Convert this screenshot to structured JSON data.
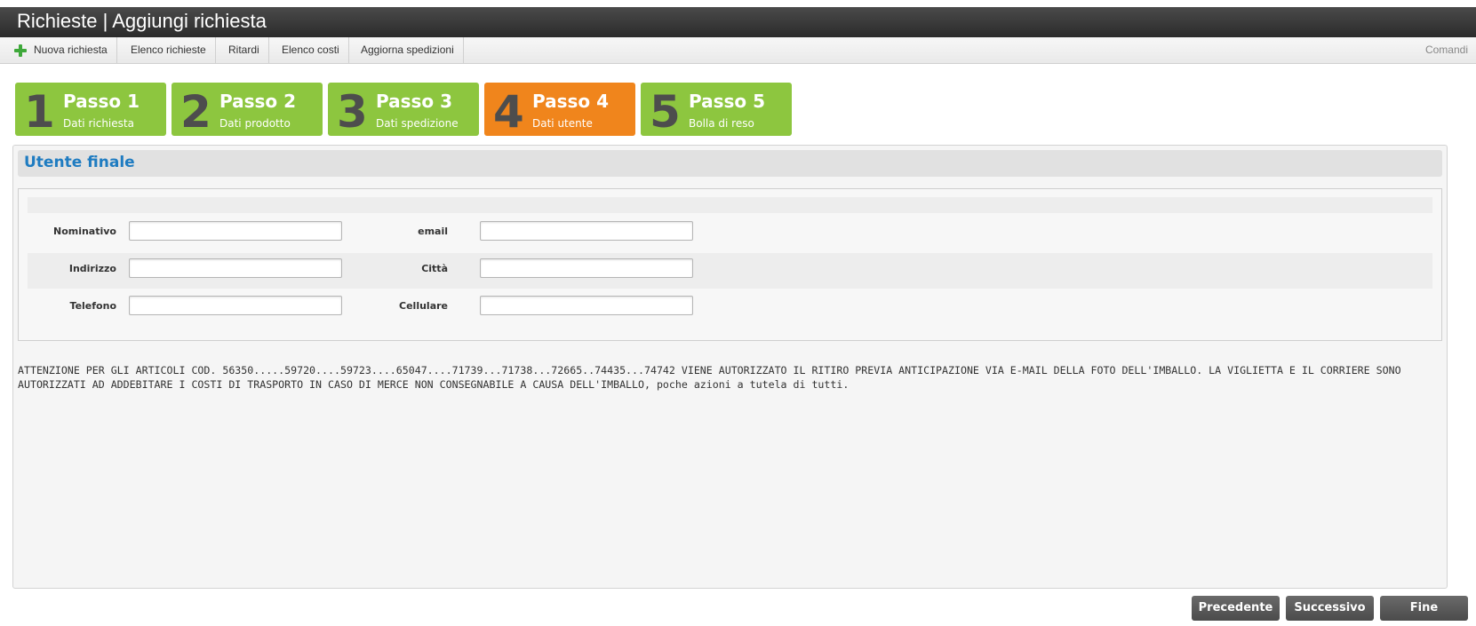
{
  "window": {
    "title": "Richieste | Aggiungi richiesta"
  },
  "toolbar": {
    "items": [
      {
        "label": "Nuova richiesta",
        "icon": "plus-icon"
      },
      {
        "label": "Elenco richieste"
      },
      {
        "label": "Ritardi"
      },
      {
        "label": "Elenco costi"
      },
      {
        "label": "Aggiorna spedizioni"
      }
    ],
    "comandi": "Comandi"
  },
  "steps": [
    {
      "num": "1",
      "title": "Passo 1",
      "subtitle": "Dati richiesta",
      "active": false
    },
    {
      "num": "2",
      "title": "Passo 2",
      "subtitle": "Dati prodotto",
      "active": false
    },
    {
      "num": "3",
      "title": "Passo 3",
      "subtitle": "Dati spedizione",
      "active": false
    },
    {
      "num": "4",
      "title": "Passo 4",
      "subtitle": "Dati utente",
      "active": true
    },
    {
      "num": "5",
      "title": "Passo 5",
      "subtitle": "Bolla di reso",
      "active": false
    }
  ],
  "colors": {
    "step_green": "#8dc63f",
    "step_active": "#f0851c",
    "section_title": "#1f7cc1",
    "button_bg": "#555555"
  },
  "section": {
    "title": "Utente finale"
  },
  "form": {
    "nominativo": {
      "label": "Nominativo",
      "value": ""
    },
    "email": {
      "label": "email",
      "value": ""
    },
    "indirizzo": {
      "label": "Indirizzo",
      "value": ""
    },
    "citta": {
      "label": "Città",
      "value": ""
    },
    "telefono": {
      "label": "Telefono",
      "value": ""
    },
    "cellulare": {
      "label": "Cellulare",
      "value": ""
    }
  },
  "notice": "ATTENZIONE PER GLI ARTICOLI COD. 56350.....59720....59723....65047....71739...71738...72665..74435...74742 VIENE AUTORIZZATO IL RITIRO PREVIA ANTICIPAZIONE VIA E-MAIL DELLA FOTO DELL'IMBALLO. LA VIGLIETTA E IL CORRIERE SONO AUTORIZZATI AD ADDEBITARE I COSTI DI TRASPORTO IN CASO DI MERCE NON CONSEGNABILE A CAUSA DELL'IMBALLO, poche azioni a tutela di tutti.",
  "buttons": {
    "precedente": "Precedente",
    "successivo": "Successivo",
    "fine": "Fine"
  }
}
